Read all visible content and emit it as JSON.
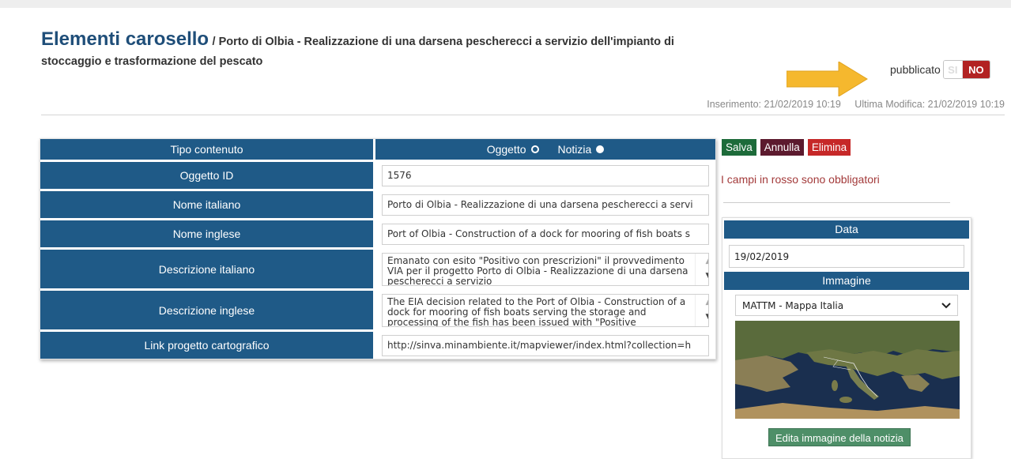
{
  "header": {
    "title": "Elementi carosello",
    "subtitle_line1": "/ Porto di Olbia - Realizzazione di una darsena pescherecci a servizio dell'impianto di",
    "subtitle_line2": "stoccaggio e trasformazione del pescato"
  },
  "publish": {
    "label": "pubblicato",
    "yes": "SI",
    "no": "NO",
    "state": "NO"
  },
  "meta": {
    "inserimento": "Inserimento: 21/02/2019 10:19",
    "modifica": "Ultima Modifica: 21/02/2019 10:19"
  },
  "form": {
    "tipo_label": "Tipo contenuto",
    "tipo_options": [
      "Oggetto",
      "Notizia"
    ],
    "tipo_selected": "Notizia",
    "oggetto_id_label": "Oggetto ID",
    "oggetto_id_value": "1576",
    "nome_it_label": "Nome italiano",
    "nome_it_value": "Porto di Olbia - Realizzazione di una darsena pescherecci a servi",
    "nome_en_label": "Nome inglese",
    "nome_en_value": "Port of Olbia - Construction of a dock for mooring of fish boats s",
    "desc_it_label": "Descrizione italiano",
    "desc_it_value": "Emanato con esito \"Positivo con prescrizioni\" il provvedimento VIA per il progetto Porto di Olbia - Realizzazione di una darsena pescherecci a servizio",
    "desc_en_label": "Descrizione inglese",
    "desc_en_value": "The EIA decision related to the Port of Olbia - Construction of a dock for mooring of fish boats serving the storage and processing of the fish has been issued with \"Positive",
    "link_label": "Link progetto cartografico",
    "link_value": "http://sinva.minambiente.it/mapviewer/index.html?collection=h"
  },
  "actions": {
    "save": "Salva",
    "cancel": "Annulla",
    "delete": "Elimina"
  },
  "required_note": "I campi in rosso sono obbligatori",
  "side": {
    "data_label": "Data",
    "data_value": "19/02/2019",
    "image_label": "Immagine",
    "image_select": "MATTM - Mappa Italia",
    "edit_button": "Edita immagine della notizia"
  },
  "colors": {
    "header_blue": "#1f5a87",
    "title_blue": "#1f4e79",
    "save_green": "#1d6b3a",
    "cancel_maroon": "#5c1a2e",
    "delete_red": "#c62828",
    "no_red": "#b22222",
    "arrow_yellow": "#f5b82e"
  },
  "icons": {
    "arrow": "right-arrow-icon",
    "select": "chevron-down-icon",
    "map": "map-thumbnail"
  }
}
